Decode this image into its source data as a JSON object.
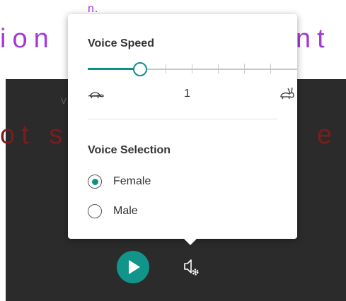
{
  "background": {
    "small_text_top": "n.",
    "line1_left": "ion",
    "line1_right": "nt",
    "small_text_mid": "v",
    "line2_left": "ot s",
    "line2_right": "e"
  },
  "voice_speed": {
    "title": "Voice Speed",
    "value_label": "1",
    "slider_level_fraction": 0.25,
    "slow_icon": "turtle-icon",
    "fast_icon": "hare-icon"
  },
  "voice_selection": {
    "title": "Voice Selection",
    "options": [
      {
        "label": "Female",
        "selected": true
      },
      {
        "label": "Male",
        "selected": false
      }
    ]
  },
  "controls": {
    "play_icon": "play-icon",
    "voice_settings_icon": "speaker-gear-icon"
  },
  "colors": {
    "accent": "#0f8f85",
    "play_button": "#11958b",
    "background_purple_text": "#a23ad6",
    "background_red_text": "#7a1d1d",
    "dark_panel": "#2b2b2b"
  }
}
